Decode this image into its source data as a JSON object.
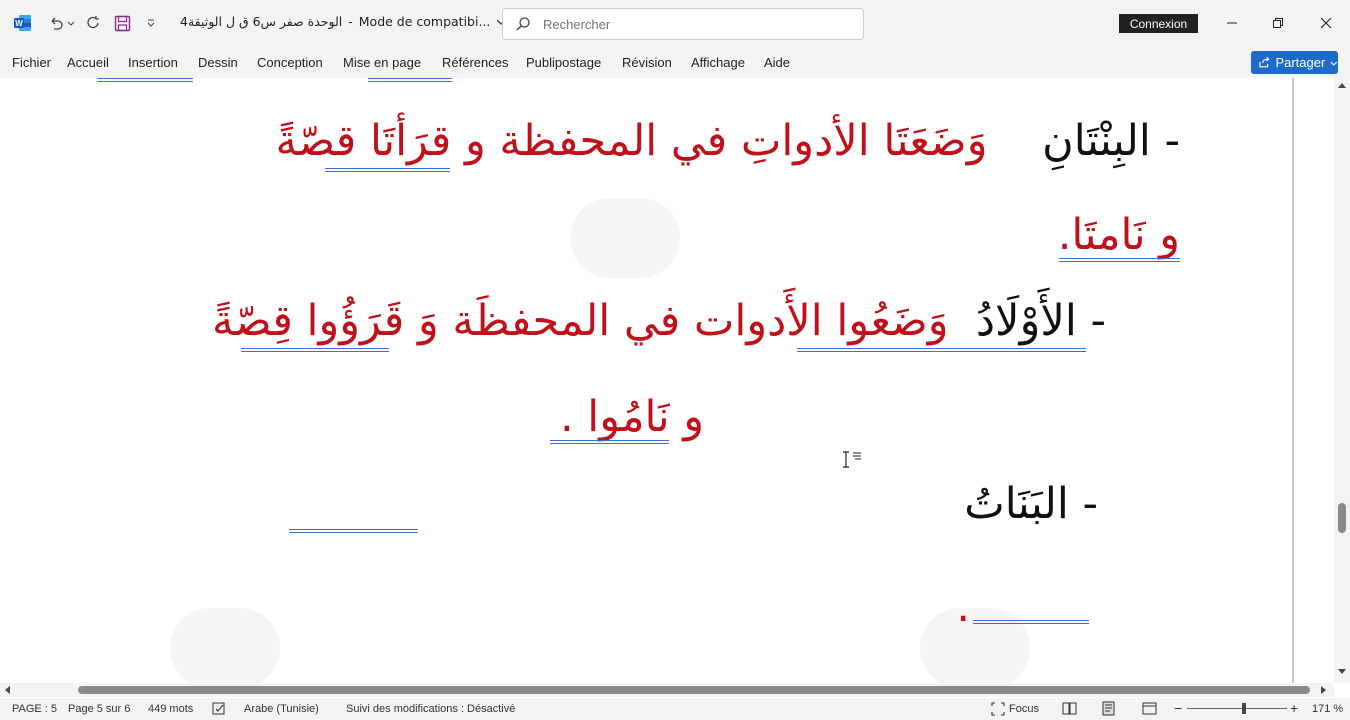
{
  "titlebar": {
    "app_icon": "word-icon",
    "doc_title": "الوحدة صفر س6 ق ل الوثيقة4",
    "compat_mode": "Mode de compatibi...",
    "search_placeholder": "Rechercher",
    "connexion_label": "Connexion"
  },
  "menu": {
    "items": [
      "Fichier",
      "Accueil",
      "Insertion",
      "Dessin",
      "Conception",
      "Mise en page",
      "Références",
      "Publipostage",
      "Révision",
      "Affichage",
      "Aide"
    ],
    "share_label": "Partager"
  },
  "document": {
    "line1_black": "- البِنْتَانِ",
    "line1_red": "وَضَعَتَا الأدواتِ في المحفظة و قرَأتَا قصّةً",
    "line2_red": "و نَامتَا.",
    "line3_black": "- الأَوْلَادُ",
    "line3_red": "وَضَعُوا الأَدوات في المحفظَة وَ قَرَؤُوا قِصّةً",
    "line4_red": "و نَامُوا .",
    "line5_black": "- البَنَاتُ",
    "line6_red": "."
  },
  "statusbar": {
    "page": "PAGE : 5",
    "page_of": "Page 5 sur 6",
    "words": "449 mots",
    "language": "Arabe (Tunisie)",
    "track_changes": "Suivi des modifications : Désactivé",
    "focus": "Focus",
    "zoom": "171 %"
  },
  "colors": {
    "accent": "#1d6ac9",
    "text_red": "#c0111b",
    "chrome": "#f3f3f3"
  }
}
